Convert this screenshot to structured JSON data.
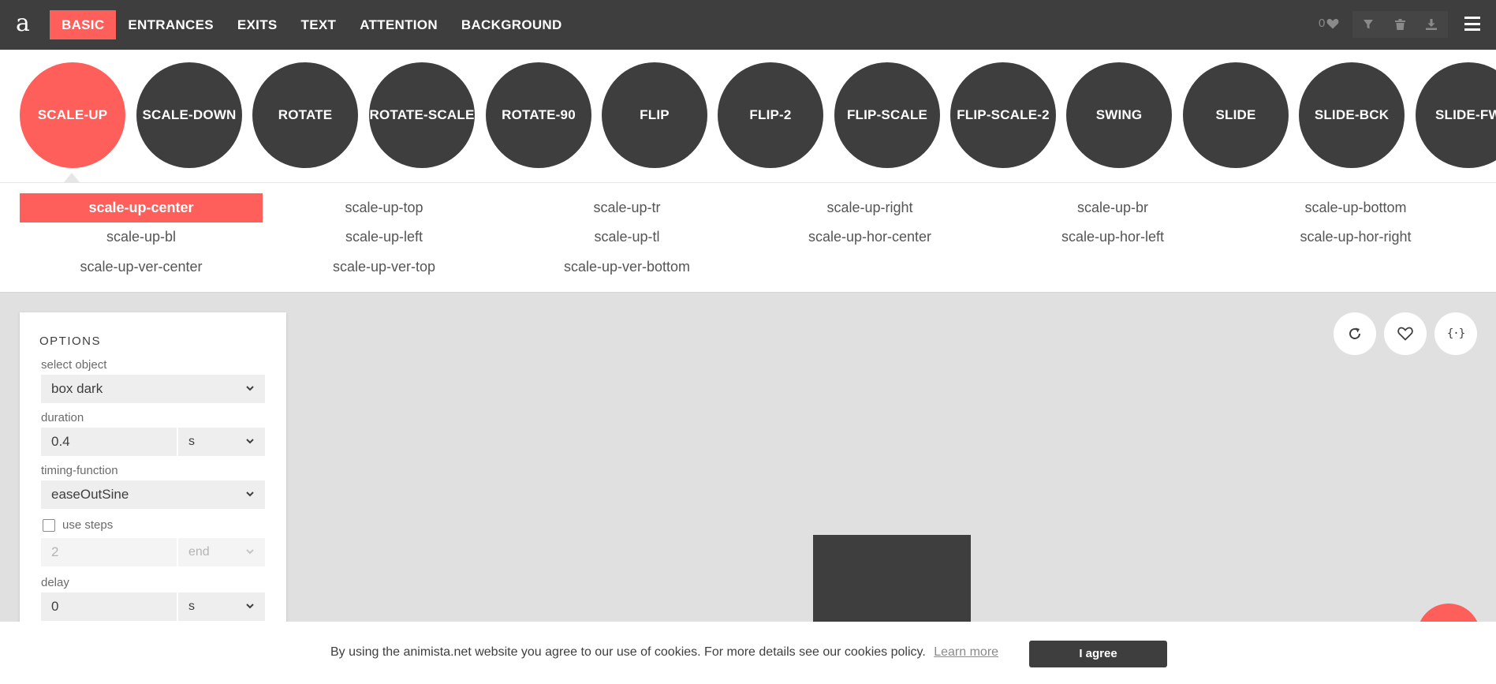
{
  "logo": {
    "text": "a"
  },
  "nav": {
    "items": [
      {
        "label": "BASIC",
        "active": true
      },
      {
        "label": "ENTRANCES",
        "active": false
      },
      {
        "label": "EXITS",
        "active": false
      },
      {
        "label": "TEXT",
        "active": false
      },
      {
        "label": "ATTENTION",
        "active": false
      },
      {
        "label": "BACKGROUND",
        "active": false
      }
    ]
  },
  "toolbar": {
    "favorites_count": "0",
    "icons": [
      "heart-icon",
      "filter-icon",
      "trash-icon",
      "download-icon",
      "menu-icon"
    ]
  },
  "animations": {
    "selected": "SCALE-UP",
    "circles": [
      "SCALE-UP",
      "SCALE-DOWN",
      "ROTATE",
      "ROTATE-SCALE",
      "ROTATE-90",
      "FLIP",
      "FLIP-2",
      "FLIP-SCALE",
      "FLIP-SCALE-2",
      "SWING",
      "SLIDE",
      "SLIDE-BCK",
      "SLIDE-FWD"
    ]
  },
  "variants": {
    "selected": "scale-up-center",
    "items": [
      "scale-up-center",
      "scale-up-top",
      "scale-up-tr",
      "scale-up-right",
      "scale-up-br",
      "scale-up-bottom",
      "scale-up-bl",
      "scale-up-left",
      "scale-up-tl",
      "scale-up-hor-center",
      "scale-up-hor-left",
      "scale-up-hor-right",
      "scale-up-ver-center",
      "scale-up-ver-top",
      "scale-up-ver-bottom"
    ]
  },
  "options": {
    "title": "OPTIONS",
    "select_object": {
      "label": "select object",
      "value": "box dark"
    },
    "duration": {
      "label": "duration",
      "value": "0.4",
      "unit": "s"
    },
    "timing_function": {
      "label": "timing-function",
      "value": "easeOutSine"
    },
    "use_steps": {
      "label": "use steps",
      "checked": false,
      "value": "2",
      "position": "end"
    },
    "delay": {
      "label": "delay",
      "value": "0",
      "unit": "s"
    }
  },
  "stage": {
    "buttons": [
      "replay-icon",
      "heart-icon",
      "code-icon"
    ],
    "code_glyph": "{·}"
  },
  "cookie": {
    "text": "By using the animista.net website you agree to our use of cookies. For more details see our cookies policy.",
    "link": "Learn more",
    "button": "I agree"
  },
  "colors": {
    "accent": "#fe5f5a",
    "dark": "#3e3e3e",
    "stage": "#e0e0e0"
  }
}
